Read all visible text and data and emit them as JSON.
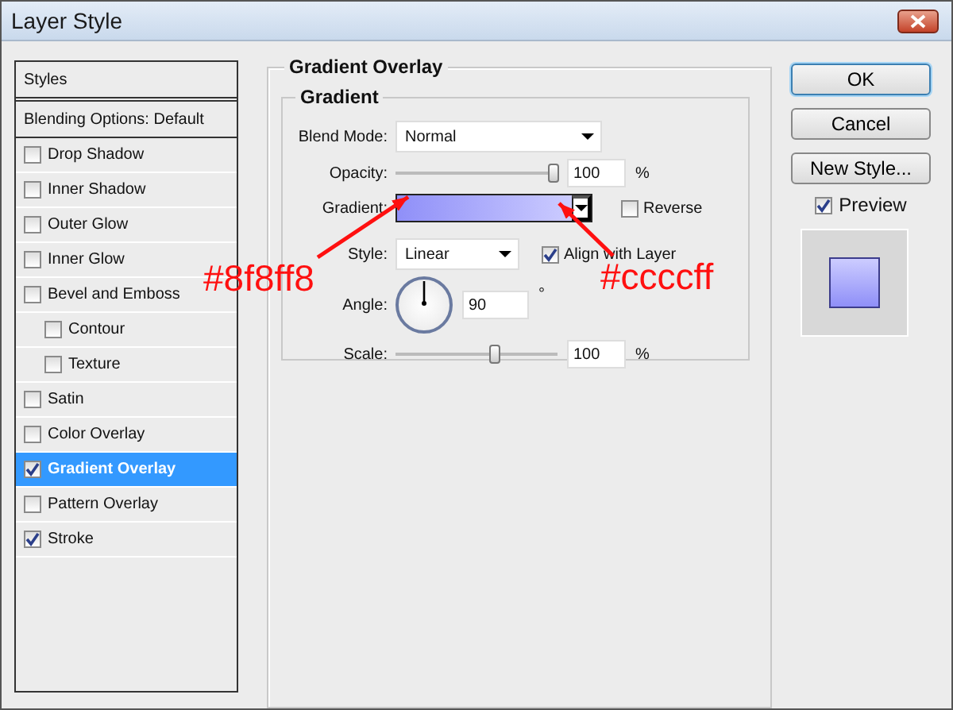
{
  "window": {
    "title": "Layer Style"
  },
  "styles_panel": {
    "header": "Styles",
    "blending_options": "Blending Options: Default",
    "effects": [
      {
        "label": "Drop Shadow",
        "checked": false,
        "selected": false
      },
      {
        "label": "Inner Shadow",
        "checked": false,
        "selected": false
      },
      {
        "label": "Outer Glow",
        "checked": false,
        "selected": false
      },
      {
        "label": "Inner Glow",
        "checked": false,
        "selected": false
      },
      {
        "label": "Bevel and Emboss",
        "checked": false,
        "selected": false,
        "children": [
          {
            "label": "Contour",
            "checked": false,
            "selected": false
          },
          {
            "label": "Texture",
            "checked": false,
            "selected": false
          }
        ]
      },
      {
        "label": "Satin",
        "checked": false,
        "selected": false
      },
      {
        "label": "Color Overlay",
        "checked": false,
        "selected": false
      },
      {
        "label": "Gradient Overlay",
        "checked": true,
        "selected": true
      },
      {
        "label": "Pattern Overlay",
        "checked": false,
        "selected": false
      },
      {
        "label": "Stroke",
        "checked": true,
        "selected": false
      }
    ]
  },
  "gradient_overlay": {
    "title": "Gradient Overlay",
    "group_title": "Gradient",
    "blend_mode": {
      "label": "Blend Mode:",
      "value": "Normal"
    },
    "opacity": {
      "label": "Opacity:",
      "level": 0.98,
      "value": "100",
      "unit": "%"
    },
    "gradient": {
      "label": "Gradient:",
      "reverse": {
        "label": "Reverse",
        "checked": false
      }
    },
    "style": {
      "label": "Style:",
      "value": "Linear",
      "align_with_layer": {
        "label": "Align with Layer",
        "checked": true
      }
    },
    "angle": {
      "label": "Angle:",
      "value": "90",
      "unit": "°"
    },
    "scale": {
      "label": "Scale:",
      "level": 0.62,
      "value": "100",
      "unit": "%"
    }
  },
  "buttons": [
    "OK",
    "Cancel",
    "New Style..."
  ],
  "preview": {
    "label": "Preview",
    "checked": true
  },
  "annotations": [
    {
      "text": "#8f8ff8"
    },
    {
      "text": "#ccccff"
    }
  ]
}
